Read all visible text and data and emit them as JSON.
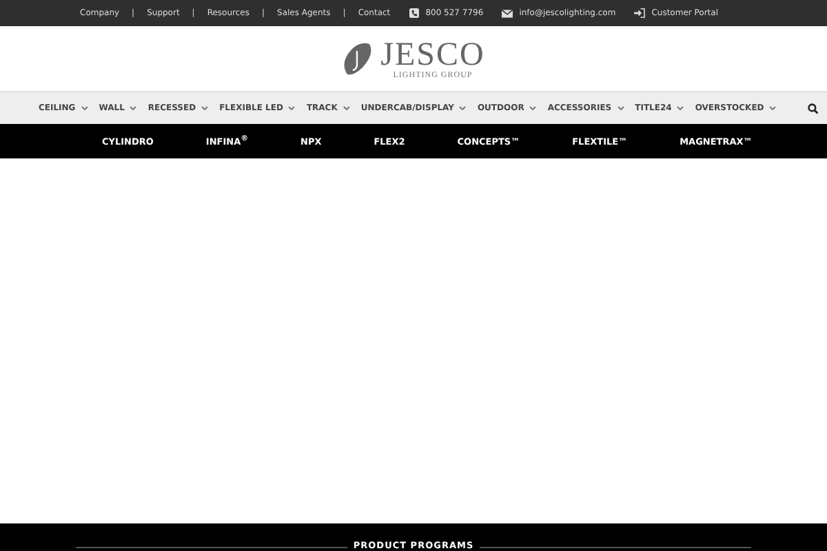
{
  "top_links": [
    "Company",
    "Support",
    "Resources",
    "Sales Agents",
    "Contact"
  ],
  "top_link_separators": [
    "|",
    "|",
    "|",
    "|"
  ],
  "contact": {
    "phone": "800 527 7796",
    "email": "info@jescolighting.com",
    "portal": "Customer Portal"
  },
  "logo": {
    "name": "JESCO",
    "tagline": "LIGHTING GROUP"
  },
  "main_nav": [
    "CEILING",
    "WALL",
    "RECESSED",
    "FLEXIBLE LED",
    "TRACK",
    "UNDERCAB/DISPLAY",
    "OUTDOOR",
    "ACCESSORIES",
    "TITLE24",
    "OVERSTOCKED"
  ],
  "programs": [
    "CYLINDRO",
    "INFINA$^{®}$",
    "NPX",
    "FLEX2",
    "CONCEPTS™",
    "FLEXTILE™",
    "MAGNETRAX™"
  ],
  "footer": {
    "heading": "PRODUCT PROGRAMS"
  }
}
